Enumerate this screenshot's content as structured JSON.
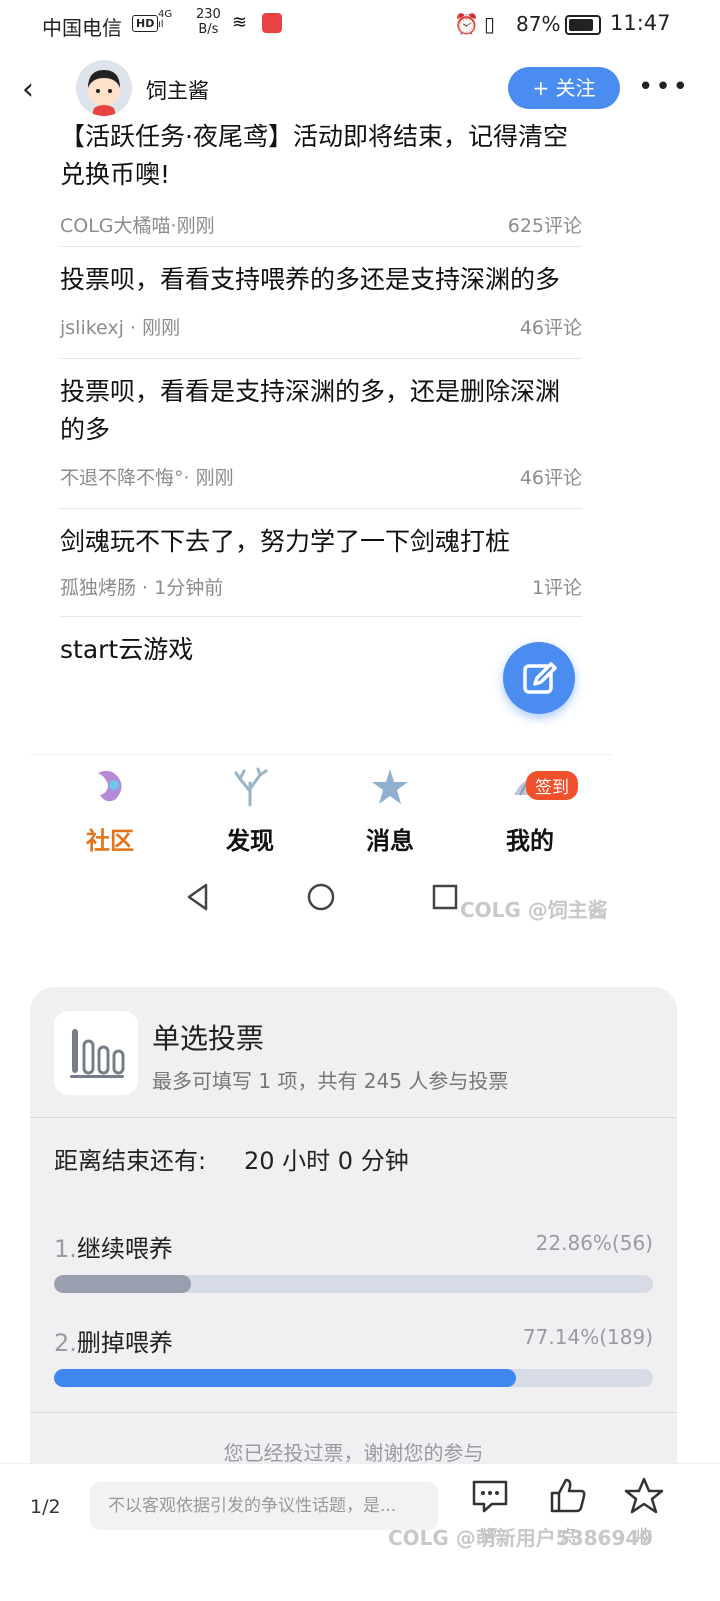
{
  "status_bar": {
    "carrier": "中国电信",
    "hd": "HD",
    "network_top": "4G",
    "network_bottom": "ıl",
    "speed_value": "230",
    "speed_unit": "B/s",
    "battery": "87%",
    "time": "11:47"
  },
  "header": {
    "username": "饲主酱",
    "follow_label": "+ 关注",
    "more_label": "•••"
  },
  "feed": {
    "items": [
      {
        "title": "【活跃任务·夜尾鸢】活动即将结束，记得清空兑换币噢!",
        "author": "COLG大橘喵",
        "time": "刚刚",
        "comments": "625评论"
      },
      {
        "title": "投票呗，看看支持喂养的多还是支持深渊的多",
        "author": "jslikexj ",
        "time": "刚刚",
        "comments": "46评论"
      },
      {
        "title": "投票呗，看看是支持深渊的多，还是删除深渊的多",
        "author": "不退不降不悔°",
        "time": "刚刚",
        "comments": "46评论"
      },
      {
        "title": "剑魂玩不下去了，努力学了一下剑魂打桩",
        "author": "孤独烤肠 ",
        "time": "1分钟前",
        "comments": "1评论"
      },
      {
        "title": "start云游戏",
        "author": "",
        "time": "",
        "comments": ""
      }
    ]
  },
  "tabs": [
    {
      "label": "社区",
      "active": true
    },
    {
      "label": "发现",
      "active": false
    },
    {
      "label": "消息",
      "active": false
    },
    {
      "label": "我的",
      "active": false,
      "badge": "签到"
    }
  ],
  "watermark_top": "COLG @饲主酱",
  "vote": {
    "title": "单选投票",
    "subtitle": "最多可填写 1 项，共有 245 人参与投票",
    "countdown_label": "距离结束还有:",
    "countdown_value": "20 小时 0 分钟",
    "options": [
      {
        "index": "1.",
        "name": "继续喂养",
        "stat": "22.86%(56)",
        "fraction": 0.2286,
        "color": "#9a9fb0"
      },
      {
        "index": "2.",
        "name": "删掉喂养",
        "stat": "77.14%(189)",
        "fraction": 0.7714,
        "color": "#3f86f0"
      }
    ],
    "voted_note": "您已经投过票，谢谢您的参与"
  },
  "bottom_bar": {
    "page_indicator": "1/2",
    "comment_placeholder": "不以客观依据引发的争议性话题，是...",
    "actions": [
      {
        "icon": "comment-icon",
        "label": "评"
      },
      {
        "icon": "like-icon",
        "label": "点"
      },
      {
        "icon": "star-icon",
        "label": "收"
      }
    ],
    "watermark": "COLG @萌新用户5386949"
  }
}
